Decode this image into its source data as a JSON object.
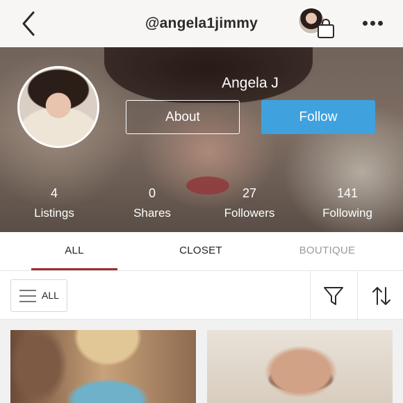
{
  "header": {
    "username": "@angela1jimmy"
  },
  "profile": {
    "display_name": "Angela J",
    "about_label": "About",
    "follow_label": "Follow",
    "stats": [
      {
        "value": "4",
        "label": "Listings"
      },
      {
        "value": "0",
        "label": "Shares"
      },
      {
        "value": "27",
        "label": "Followers"
      },
      {
        "value": "141",
        "label": "Following"
      }
    ]
  },
  "tabs": [
    {
      "label": "ALL",
      "active": true
    },
    {
      "label": "CLOSET",
      "active": false
    },
    {
      "label": "BOUTIQUE",
      "active": false
    }
  ],
  "filter": {
    "all_label": "ALL"
  },
  "colors": {
    "accent_follow": "#3fa2df",
    "active_tab_underline": "#9e2a2f",
    "inactive_tab_text": "#9a9a9a"
  },
  "icons": [
    "back-icon",
    "shopping-bag-icon",
    "more-icon",
    "hamburger-icon",
    "filter-icon",
    "sort-icon"
  ]
}
